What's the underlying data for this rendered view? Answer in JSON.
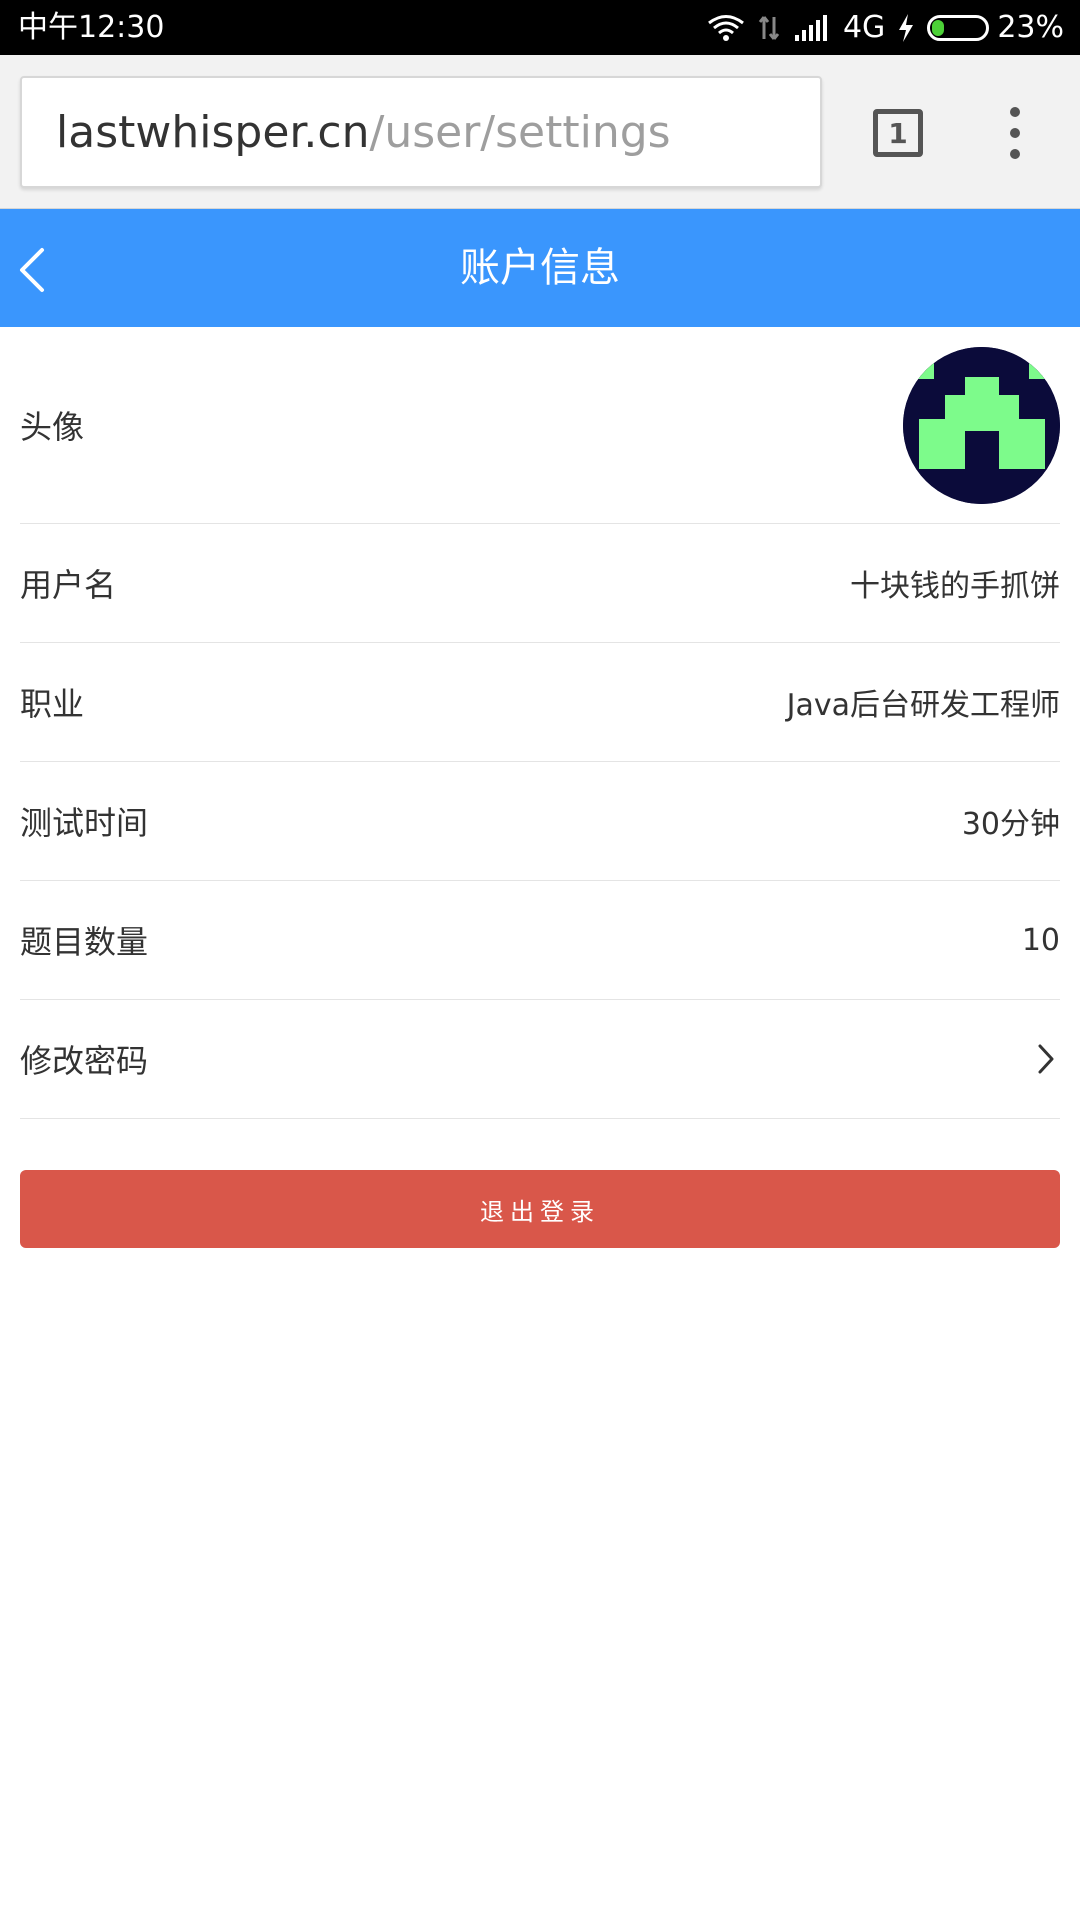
{
  "status_bar": {
    "time": "中午12:30",
    "network": "4G",
    "battery_percent": "23%",
    "battery_level": 0.23,
    "icons": [
      "wifi-icon",
      "data-arrows-icon",
      "signal-icon",
      "charging-icon",
      "battery-icon"
    ]
  },
  "browser": {
    "url_domain": "lastwhisper.cn",
    "url_path": "/user/settings",
    "tab_count": "1",
    "menu_icon": "more-vert-icon"
  },
  "header": {
    "title": "账户信息",
    "back_icon": "chevron-left-icon",
    "background_color": "#3a96fd"
  },
  "settings": {
    "avatar_label": "头像",
    "username_label": "用户名",
    "username_value": "十块钱的手抓饼",
    "job_label": "职业",
    "job_value": "Java后台研发工程师",
    "test_time_label": "测试时间",
    "test_time_value": "30分钟",
    "question_count_label": "题目数量",
    "question_count_value": "10",
    "change_password_label": "修改密码",
    "change_password_icon": "chevron-right-icon"
  },
  "logout": {
    "label": "退出登录",
    "color": "#d9574a"
  },
  "colors": {
    "avatar_background": "#0b0b3a",
    "avatar_pattern": "#7dfb8b"
  }
}
